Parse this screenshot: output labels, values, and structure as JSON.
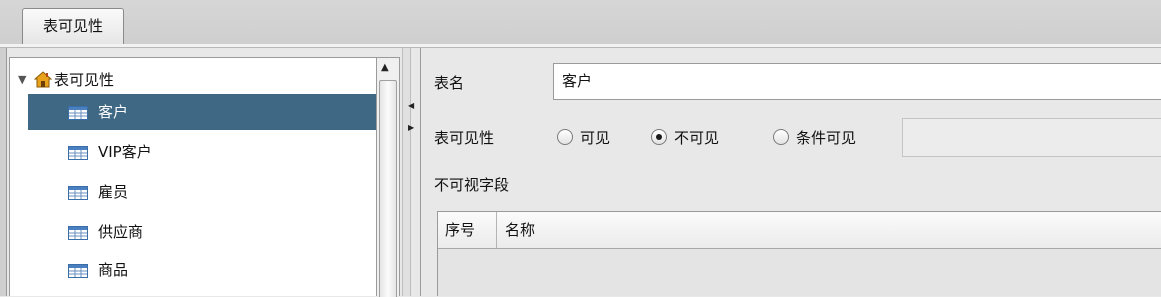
{
  "tabs": [
    {
      "label": "表可见性",
      "active": true
    }
  ],
  "tree": {
    "root": {
      "label": "表可见性",
      "expanded": true,
      "icon": "house-icon"
    },
    "items": [
      {
        "label": "客户",
        "selected": true,
        "icon": "table-icon"
      },
      {
        "label": "VIP客户",
        "selected": false,
        "icon": "table-icon"
      },
      {
        "label": "雇员",
        "selected": false,
        "icon": "table-icon"
      },
      {
        "label": "供应商",
        "selected": false,
        "icon": "table-icon"
      },
      {
        "label": "商品",
        "selected": false,
        "icon": "table-icon"
      }
    ]
  },
  "form": {
    "table_name_label": "表名",
    "table_name_value": "客户",
    "visibility_label": "表可见性",
    "visibility_options": [
      {
        "label": "可见",
        "checked": false
      },
      {
        "label": "不可见",
        "checked": true
      },
      {
        "label": "条件可见",
        "checked": false
      }
    ],
    "condition_value": "",
    "invisible_fields_label": "不可视字段",
    "grid_columns": [
      "序号",
      "名称"
    ],
    "grid_rows": []
  },
  "colors": {
    "selection": "#3e6883",
    "background": "#e8e8e8"
  }
}
